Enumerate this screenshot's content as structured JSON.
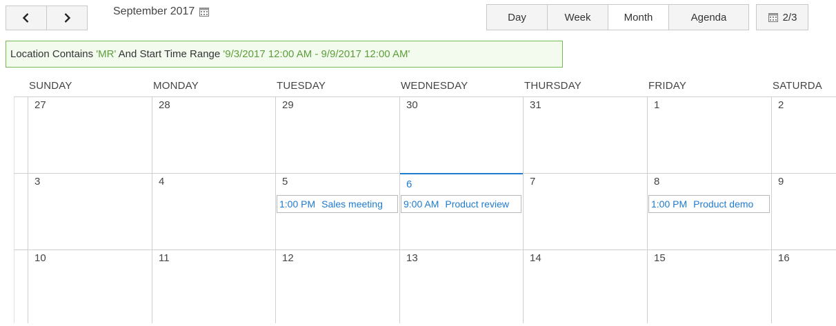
{
  "toolbar": {
    "prev_label": "previous",
    "next_label": "next",
    "month_title": "September 2017",
    "views": [
      "Day",
      "Week",
      "Month",
      "Agenda"
    ],
    "active_view": "Month",
    "page_indicator": "2/3"
  },
  "filter": {
    "part1": "Location Contains ",
    "value1": "'MR'",
    "part2": " And Start Time Range ",
    "value2": "'9/3/2017 12:00 AM - 9/9/2017 12:00 AM'"
  },
  "weekdays": [
    "SUNDAY",
    "MONDAY",
    "TUESDAY",
    "WEDNESDAY",
    "THURSDAY",
    "FRIDAY",
    "SATURDA"
  ],
  "weeks": [
    [
      "27",
      "28",
      "29",
      "30",
      "31",
      "1",
      "2"
    ],
    [
      "3",
      "4",
      "5",
      "6",
      "7",
      "8",
      "9"
    ],
    [
      "10",
      "11",
      "12",
      "13",
      "14",
      "15",
      "16"
    ]
  ],
  "today": "6",
  "events": [
    {
      "day": "5",
      "time": "1:00 PM",
      "title": "Sales meeting"
    },
    {
      "day": "6",
      "time": "9:00 AM",
      "title": "Product review"
    },
    {
      "day": "8",
      "time": "1:00 PM",
      "title": "Product demo"
    }
  ],
  "colors": {
    "accent": "#1e7bcf",
    "filter_border": "#76b852",
    "filter_value": "#5c9e3a",
    "grid": "#cfcfcf"
  }
}
